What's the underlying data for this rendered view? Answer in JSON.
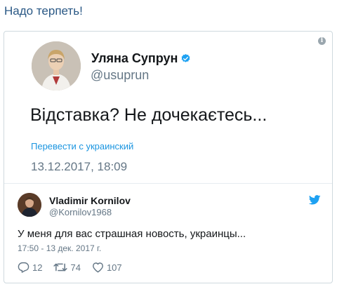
{
  "headline": "Надо терпеть!",
  "main_tweet": {
    "display_name": "Уляна Супрун",
    "handle": "@usuprun",
    "text": "Відставка? Не дочекаєтесь...",
    "translate_link": "Перевести с украинский",
    "timestamp": "13.12.2017, 18:09"
  },
  "reply_tweet": {
    "display_name": "Vladimir Kornilov",
    "handle": "@Kornilov1968",
    "text": "У меня для вас страшная новость, украинцы...",
    "timestamp": "17:50 - 13 дек. 2017 г.",
    "replies": "12",
    "retweets": "74",
    "likes": "107"
  },
  "icons": {
    "info": "info-icon",
    "verified": "verified-badge-icon",
    "twitter": "twitter-bird-icon",
    "reply": "reply-icon",
    "retweet": "retweet-icon",
    "like": "heart-icon"
  },
  "colors": {
    "link": "#1b95e0",
    "headline": "#2a5885",
    "muted": "#657786"
  }
}
